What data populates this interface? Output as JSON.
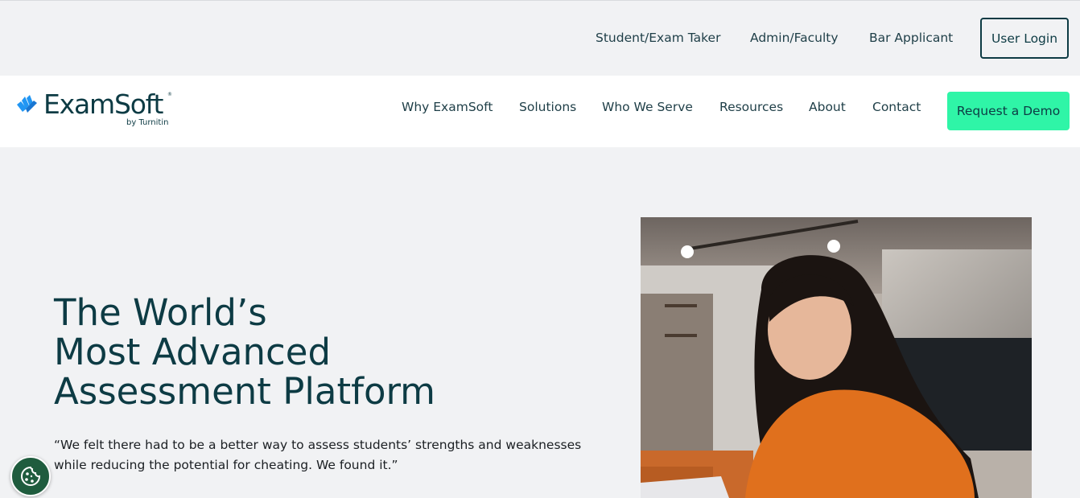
{
  "utility_nav": {
    "links": [
      "Student/Exam Taker",
      "Admin/Faculty",
      "Bar Applicant"
    ],
    "login_label": "User Login"
  },
  "brand": {
    "name": "ExamSoft",
    "registered_mark": "®",
    "byline": "by Turnitin",
    "accent_color": "#2196f3"
  },
  "main_nav": {
    "items": [
      "Why ExamSoft",
      "Solutions",
      "Who We Serve",
      "Resources",
      "About",
      "Contact"
    ],
    "cta_label": "Request a Demo",
    "cta_color": "#2ff5a7"
  },
  "hero": {
    "title_lines": [
      "The World’s",
      "Most Advanced",
      "Assessment Platform"
    ],
    "quote": "“We felt there had to be a better way to assess students’ strengths and weaknesses while reducing the potential for cheating. We found it.”",
    "image_icon": "photo-woman-orange-sweater-laptop"
  },
  "cookie_widget": {
    "icon": "cookie-icon",
    "color": "#1f5c3e"
  },
  "colors": {
    "page_bg": "#f1f2f4",
    "text_dark": "#0d3b44"
  }
}
